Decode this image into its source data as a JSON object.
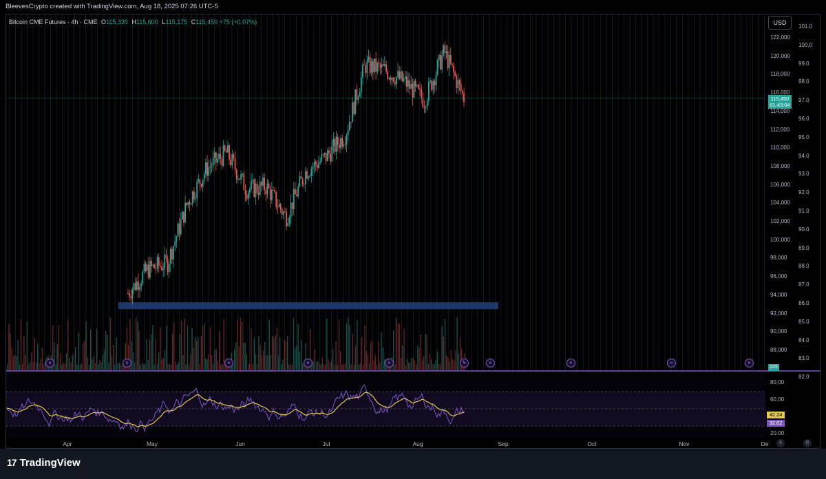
{
  "credit": "BleevesCrypto created with TradingView.com, Aug 18, 2025 07:26 UTC-5",
  "legend": {
    "symbol": "Bitcoin CME Futures · 4h · CME",
    "open_key": "O",
    "open": "115,335",
    "high_key": "H",
    "high": "115,600",
    "low_key": "L",
    "low": "115,175",
    "close_key": "C",
    "close": "115,450",
    "change": "+75 (+0.07%)"
  },
  "currency_button": "USD",
  "price_axis": [
    "122,000",
    "120,000",
    "118,000",
    "116,000",
    "114,000",
    "112,000",
    "110,000",
    "108,000",
    "106,000",
    "104,000",
    "102,000",
    "100,000",
    "98,000",
    "96,000",
    "94,000",
    "92,000",
    "90,000",
    "88,000"
  ],
  "secondary_axis": [
    "101.0",
    "100.0",
    "99.0",
    "98.0",
    "97.0",
    "96.0",
    "95.0",
    "94.0",
    "93.0",
    "92.0",
    "91.0",
    "90.0",
    "89.0",
    "88.0",
    "87.0",
    "86.0",
    "85.0",
    "84.0",
    "83.0",
    "82.0"
  ],
  "price_tag": {
    "price": "115,450",
    "countdown": "01:43:04"
  },
  "volume_tag": "225",
  "rsi_axis": [
    "80.00",
    "60.00",
    "20.00"
  ],
  "rsi_tags": {
    "ma": "42.24",
    "rsi": "32.62"
  },
  "time_axis": [
    "Apr",
    "May",
    "Jun",
    "Jul",
    "Aug",
    "Sep",
    "Oct",
    "Nov",
    "De"
  ],
  "scale_buttons": {
    "auto": "A",
    "log": "B"
  },
  "brand": "TradingView",
  "colors": {
    "up": "#26a69a",
    "down": "#ef5350",
    "zone": "#1e3a6e",
    "rsi": "#7e57c2",
    "rsi_ma": "#e6c84c",
    "bg": "#000000"
  },
  "chart_data": {
    "type": "candlestick",
    "timeframe": "4h",
    "y_range": [
      86000,
      125000
    ],
    "support_zone": [
      92300,
      93000
    ],
    "closes_weekly": [
      [
        "2025-04-21",
        94200
      ],
      [
        "2025-04-28",
        96800
      ],
      [
        "2025-05-05",
        97500
      ],
      [
        "2025-05-12",
        104000
      ],
      [
        "2025-05-19",
        107800
      ],
      [
        "2025-05-26",
        109500
      ],
      [
        "2025-06-02",
        105500
      ],
      [
        "2025-06-09",
        105800
      ],
      [
        "2025-06-16",
        102500
      ],
      [
        "2025-06-23",
        107500
      ],
      [
        "2025-06-30",
        109000
      ],
      [
        "2025-07-07",
        111500
      ],
      [
        "2025-07-14",
        119000
      ],
      [
        "2025-07-21",
        118500
      ],
      [
        "2025-07-28",
        117200
      ],
      [
        "2025-08-04",
        115200
      ],
      [
        "2025-08-11",
        120500
      ],
      [
        "2025-08-18",
        115450
      ]
    ],
    "rsi_levels": [
      70,
      50,
      30
    ]
  }
}
